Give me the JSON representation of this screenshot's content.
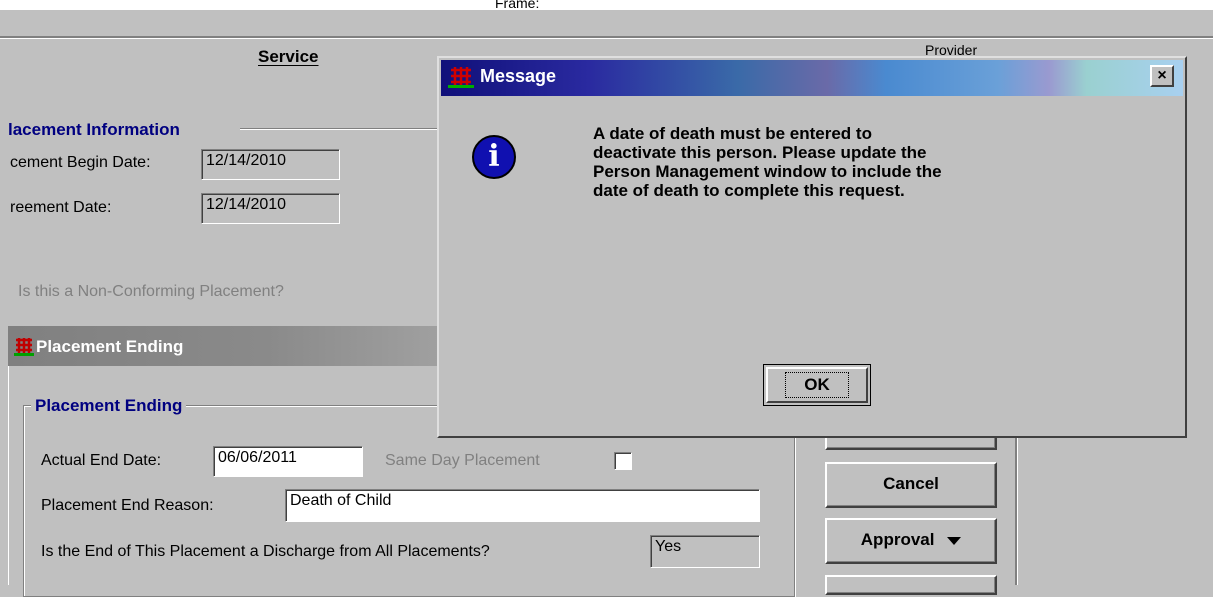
{
  "frame": {
    "label": "Frame:"
  },
  "tabs": {
    "service": "Service",
    "right": "Provider"
  },
  "placement_info": {
    "title": "lacement Information",
    "begin_date_label": "cement Begin Date:",
    "begin_date_value": "12/14/2010",
    "agreement_date_label": "reement Date:",
    "agreement_date_value": "12/14/2010",
    "nonconforming_label": "Is this a Non-Conforming Placement?"
  },
  "placement_ending_window": {
    "title": "Placement Ending",
    "group_title": "Placement Ending",
    "actual_end_date_label": "Actual End Date:",
    "actual_end_date_value": "06/06/2011",
    "same_day_label": "Same Day Placement",
    "end_reason_label": "Placement End Reason:",
    "end_reason_value": "Death of Child",
    "discharge_label": "Is the End of This Placement a Discharge from All Placements?",
    "discharge_value": "Yes"
  },
  "buttons": {
    "cancel": "Cancel",
    "approval": "Approval"
  },
  "dialog": {
    "title": "Message",
    "message_line1": "A date of death must be entered to",
    "message_line2": "deactivate this person. Please update the",
    "message_line3": "Person Management window to include the",
    "message_line4": "date of death to complete this request.",
    "ok_label": "OK",
    "close_glyph": "×"
  },
  "colors": {
    "group_title": "#000080",
    "window_bg": "#c0c0c0"
  }
}
